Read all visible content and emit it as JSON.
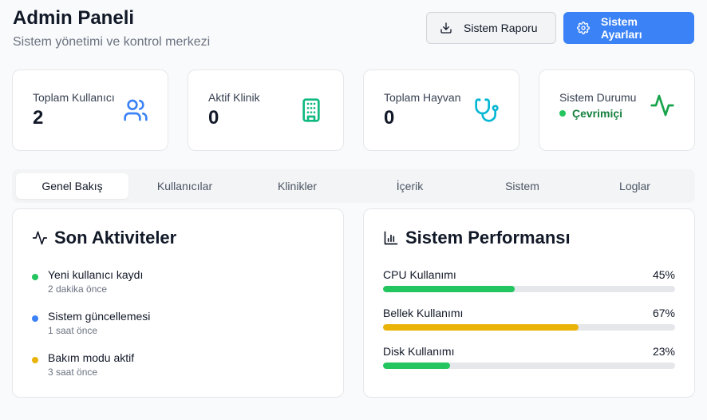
{
  "header": {
    "title": "Admin Paneli",
    "subtitle": "Sistem yönetimi ve kontrol merkezi",
    "report_button": "Sistem Raporu",
    "settings_button": "Sistem Ayarları"
  },
  "stats": [
    {
      "label": "Toplam Kullanıcı",
      "value": "2",
      "icon": "users-icon",
      "color": "#3b82f6"
    },
    {
      "label": "Aktif Klinik",
      "value": "0",
      "icon": "building-icon",
      "color": "#10b981"
    },
    {
      "label": "Toplam Hayvan",
      "value": "0",
      "icon": "stethoscope-icon",
      "color": "#06b6d4"
    },
    {
      "label": "Sistem Durumu",
      "status": "Çevrimiçi",
      "icon": "activity-icon",
      "color": "#16a34a"
    }
  ],
  "tabs": [
    "Genel Bakış",
    "Kullanıcılar",
    "Klinikler",
    "İçerik",
    "Sistem",
    "Loglar"
  ],
  "activity": {
    "title": "Son Aktiviteler",
    "items": [
      {
        "title": "Yeni kullanıcı kaydı",
        "time": "2 dakika önce",
        "color": "#22c55e"
      },
      {
        "title": "Sistem güncellemesi",
        "time": "1 saat önce",
        "color": "#3b82f6"
      },
      {
        "title": "Bakım modu aktif",
        "time": "3 saat önce",
        "color": "#eab308"
      }
    ]
  },
  "performance": {
    "title": "Sistem Performansı",
    "metrics": [
      {
        "label": "CPU Kullanımı",
        "value_text": "45%",
        "percent": 45,
        "color": "#22c55e"
      },
      {
        "label": "Bellek Kullanımı",
        "value_text": "67%",
        "percent": 67,
        "color": "#eab308"
      },
      {
        "label": "Disk Kullanımı",
        "value_text": "23%",
        "percent": 23,
        "color": "#22c55e"
      }
    ]
  }
}
